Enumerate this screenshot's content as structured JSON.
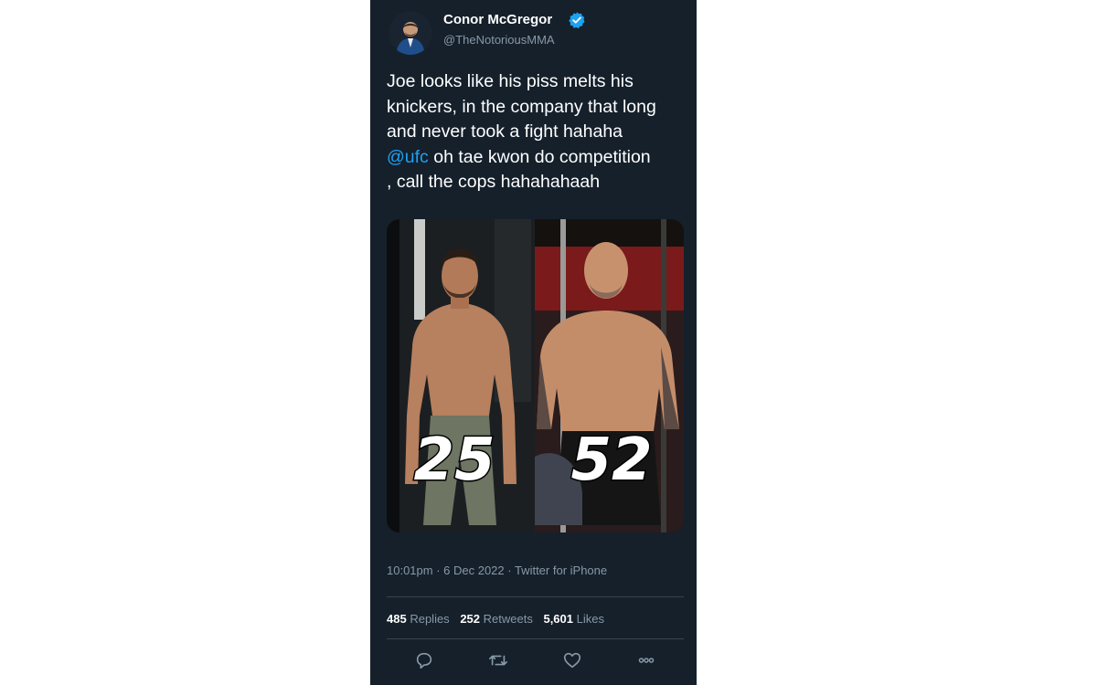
{
  "tweet": {
    "author_name": "Conor McGregor",
    "author_handle": "@TheNotoriousMMA",
    "verified": true,
    "text_lines": [
      "Joe looks like his piss melts his",
      "knickers, in the company that long",
      "and never took a fight hahaha",
      "@ufc",
      " oh tae kwon do competition",
      ", call the cops hahahahaah"
    ],
    "media": {
      "left_label": "25",
      "right_label": "52"
    },
    "timestamp": "10:01pm · 6 Dec 2022 · Twitter for iPhone",
    "stats": {
      "replies_count": "485",
      "replies_label": "Replies",
      "retweets_count": "252",
      "retweets_label": "Retweets",
      "likes_count": "5,601",
      "likes_label": "Likes"
    },
    "actions": [
      "reply-icon",
      "retweet-icon",
      "like-icon",
      "more-icon"
    ]
  },
  "colors": {
    "background": "#15202b",
    "text": "#ffffff",
    "secondary_text": "#8899a6",
    "link": "#1da1f2",
    "verified_badge": "#1da1f2",
    "divider": "#38444d"
  }
}
